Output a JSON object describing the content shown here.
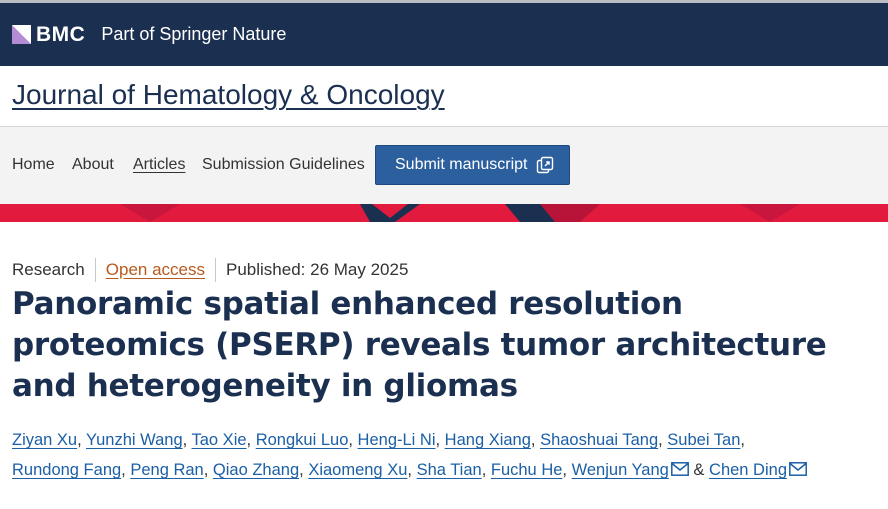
{
  "header": {
    "brand": "BMC",
    "tagline": "Part of Springer Nature",
    "colors": {
      "background": "#1b3051",
      "brand_mark": "#b48cd6"
    }
  },
  "journal": {
    "title": "Journal of Hematology & Oncology"
  },
  "nav": {
    "items": [
      {
        "label": "Home",
        "active": false
      },
      {
        "label": "About",
        "active": false
      },
      {
        "label": "Articles",
        "active": true
      },
      {
        "label": "Submission Guidelines",
        "active": false
      }
    ],
    "submit_label": "Submit manuscript",
    "submit_icon": "external-link-icon"
  },
  "article": {
    "type": "Research",
    "access": "Open access",
    "published": "Published: 26 May 2025",
    "title": "Panoramic spatial enhanced resolution proteomics (PSERP) reveals tumor architecture and heterogeneity in gliomas",
    "authors": [
      {
        "name": "Ziyan Xu",
        "sep": ", ",
        "mail": false
      },
      {
        "name": "Yunzhi Wang",
        "sep": ", ",
        "mail": false
      },
      {
        "name": "Tao Xie",
        "sep": ", ",
        "mail": false
      },
      {
        "name": "Rongkui Luo",
        "sep": ", ",
        "mail": false
      },
      {
        "name": "Heng-Li Ni",
        "sep": ", ",
        "mail": false
      },
      {
        "name": "Hang Xiang",
        "sep": ", ",
        "mail": false
      },
      {
        "name": "Shaoshuai Tang",
        "sep": ", ",
        "mail": false
      },
      {
        "name": "Subei Tan",
        "sep": ",",
        "mail": false
      },
      {
        "name": "Rundong Fang",
        "sep": ", ",
        "mail": false
      },
      {
        "name": "Peng Ran",
        "sep": ", ",
        "mail": false
      },
      {
        "name": "Qiao Zhang",
        "sep": ", ",
        "mail": false
      },
      {
        "name": "Xiaomeng Xu",
        "sep": ", ",
        "mail": false
      },
      {
        "name": "Sha Tian",
        "sep": ", ",
        "mail": false
      },
      {
        "name": "Fuchu He",
        "sep": ", ",
        "mail": false
      },
      {
        "name": "Wenjun Yang",
        "sep": " & ",
        "mail": true
      },
      {
        "name": "Chen Ding",
        "sep": "",
        "mail": true
      }
    ],
    "colors": {
      "title": "#1b3051",
      "link": "#1b5fa6",
      "open_access": "#b85a1e"
    }
  },
  "banner": {
    "colors": {
      "primary": "#e21a3d",
      "dark": "#b8143a",
      "navy": "#1b3051"
    }
  }
}
